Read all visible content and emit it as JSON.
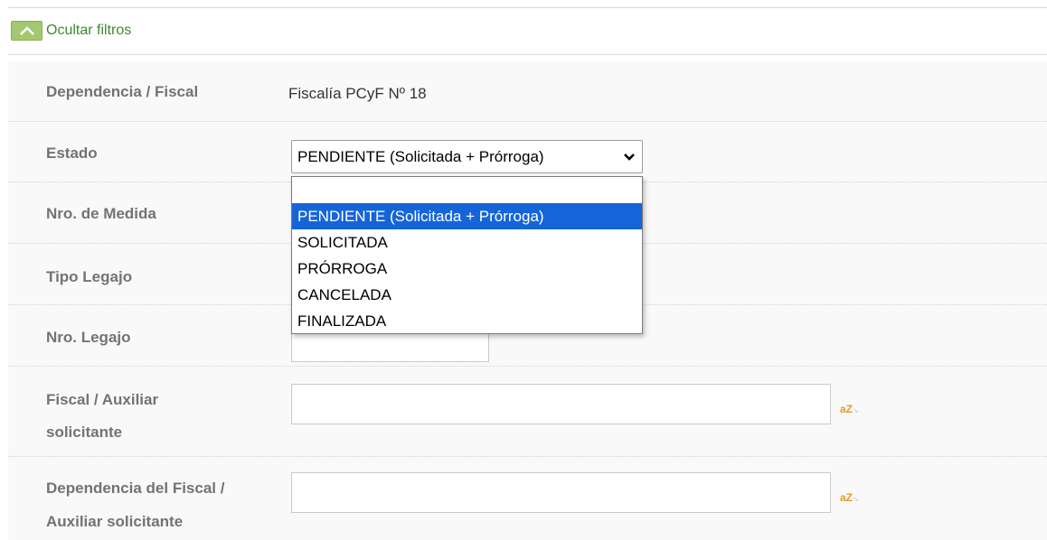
{
  "filters_toggle": {
    "label": "Ocultar filtros",
    "icon": "chevron-up-icon"
  },
  "fields": {
    "dependencia": {
      "label": "Dependencia / Fiscal",
      "value": "Fiscalía PCyF Nº 18"
    },
    "estado": {
      "label": "Estado",
      "selected": "PENDIENTE (Solicitada + Prórroga)",
      "options": [
        "",
        "PENDIENTE (Solicitada + Prórroga)",
        "SOLICITADA",
        "PRÓRROGA",
        "CANCELADA",
        "FINALIZADA"
      ],
      "highlighted_option": "PENDIENTE (Solicitada + Prórroga)"
    },
    "nro_medida": {
      "label": "Nro. de Medida"
    },
    "tipo_legajo": {
      "label": "Tipo Legajo"
    },
    "nro_legajo": {
      "label": "Nro. Legajo",
      "value": ""
    },
    "fiscal_aux": {
      "label_line1": "Fiscal / Auxiliar",
      "label_line2": "solicitante",
      "value": "",
      "icon": "az-autocomplete-icon",
      "icon_text": "aZ"
    },
    "dep_fiscal_aux": {
      "label_line1": "Dependencia del Fiscal /",
      "label_line2": "Auxiliar solicitante",
      "value": "",
      "icon": "az-autocomplete-icon",
      "icon_text": "aZ"
    }
  },
  "colors": {
    "toggle_green": "#a3c86f",
    "toggle_text": "#3b8c2a",
    "label_gray": "#737373",
    "selected_option_bg": "#1565d8",
    "az_icon": "#e69a24"
  }
}
